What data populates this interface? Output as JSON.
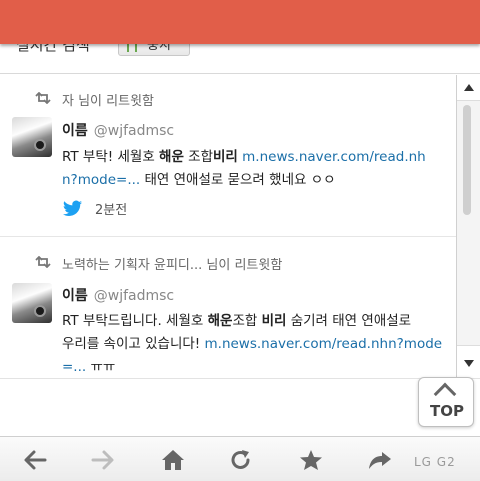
{
  "header": {
    "label": "실시간 검색",
    "button_label": "중지"
  },
  "tweets": [
    {
      "retweet_text": "자 님이 리트윗함",
      "name": "이름",
      "handle": "@wjfadmsc",
      "line1": {
        "plain": "RT 부탁! 세월호 ",
        "bold1": "해운",
        "mid": " 조합",
        "bold2": "비리",
        "link": "m.news.naver.com/read.nh"
      },
      "line2": {
        "link": "n?mode=...",
        "plain": " 태연 연애설로 묻으려 했네요 ㅇㅇ"
      },
      "time": "2분전"
    },
    {
      "retweet_text": "노력하는 기획자 윤피디... 님이 리트윗함",
      "name": "이름",
      "handle": "@wjfadmsc",
      "line1": {
        "plain": "RT 부탁드립니다. 세월호 ",
        "bold1": "해운",
        "mid": "조합 ",
        "bold2": "비리",
        "rest": " 숨기려 태연 연애설로"
      },
      "line2": {
        "plain": "우리를 속이고 있습니다! ",
        "link": "m.news.naver.com/read.nhn?mode"
      },
      "line3": {
        "link": "=...",
        "plain": " ㅠㅠ"
      }
    }
  ],
  "top_button_label": "TOP",
  "nav": {
    "items": [
      "back-icon",
      "forward-icon",
      "home-icon",
      "refresh-icon",
      "star-icon",
      "share-icon"
    ]
  },
  "watermark": "LG G2",
  "colors": {
    "accent_bar": "#e15e49",
    "link": "#1b6fa8",
    "twitter_blue": "#1da1f2"
  }
}
